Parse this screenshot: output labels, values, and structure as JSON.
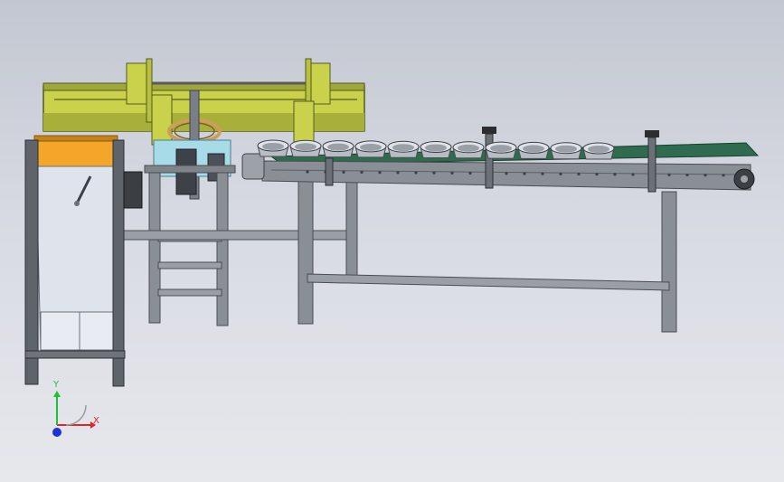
{
  "viewport": {
    "background_top": "#c3c7d1",
    "background_bottom": "#e6e8ec"
  },
  "colors": {
    "frame": "#8a8e95",
    "frame_dark": "#5b5f66",
    "gantry_yellow": "#c9d24a",
    "gantry_dark": "#8c9430",
    "hopper_orange": "#f3a62a",
    "conveyor_belt": "#2f6b4f",
    "cyan_panel": "#a8dbe8",
    "cup_rim": "#dfe3e8",
    "cup_inner": "#9aa0a8"
  },
  "triad": {
    "x_label": "X",
    "y_label": "Y",
    "x_color": "#e0252b",
    "y_color": "#1fbf3a",
    "z_color": "#1a33d6"
  },
  "icons": {
    "axis": "coordinate-triad-icon"
  },
  "cups": {
    "count": 11
  }
}
